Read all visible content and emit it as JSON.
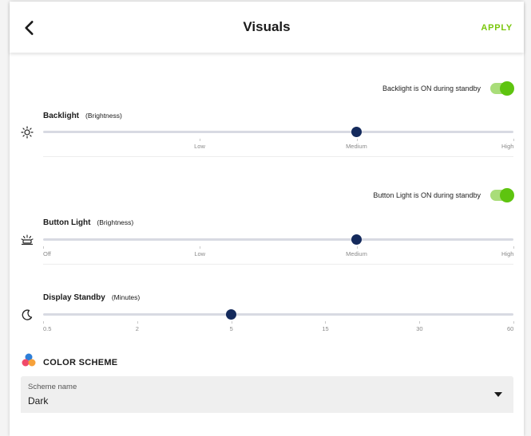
{
  "header": {
    "title": "Visuals",
    "apply_label": "APPLY",
    "back_icon": "chevron-left-icon"
  },
  "colors": {
    "accent_green": "#7ac70c",
    "toggle_on": "#5ec40f",
    "slider_thumb": "#142a5c"
  },
  "backlight": {
    "standby_label": "Backlight is ON during standby",
    "standby_on": true,
    "title": "Backlight",
    "subtitle": "(Brightness)",
    "icon": "sun-icon",
    "value": "Medium",
    "value_fraction": 0.667,
    "ticks": [
      "Low",
      "Medium",
      "High"
    ]
  },
  "button_light": {
    "standby_label": "Button Light is ON during standby",
    "standby_on": true,
    "title": "Button Light",
    "subtitle": "(Brightness)",
    "icon": "button-light-icon",
    "value": "Medium",
    "value_fraction": 0.667,
    "ticks": [
      "Off",
      "Low",
      "Medium",
      "High"
    ]
  },
  "display_standby": {
    "title": "Display Standby",
    "subtitle": "(Minutes)",
    "icon": "moon-icon",
    "value": "5",
    "value_fraction": 0.4,
    "ticks": [
      "0.5",
      "2",
      "5",
      "15",
      "30",
      "60"
    ]
  },
  "color_scheme": {
    "title": "COLOR SCHEME",
    "icon": "palette-icon",
    "select_label": "Scheme name",
    "select_value": "Dark"
  }
}
